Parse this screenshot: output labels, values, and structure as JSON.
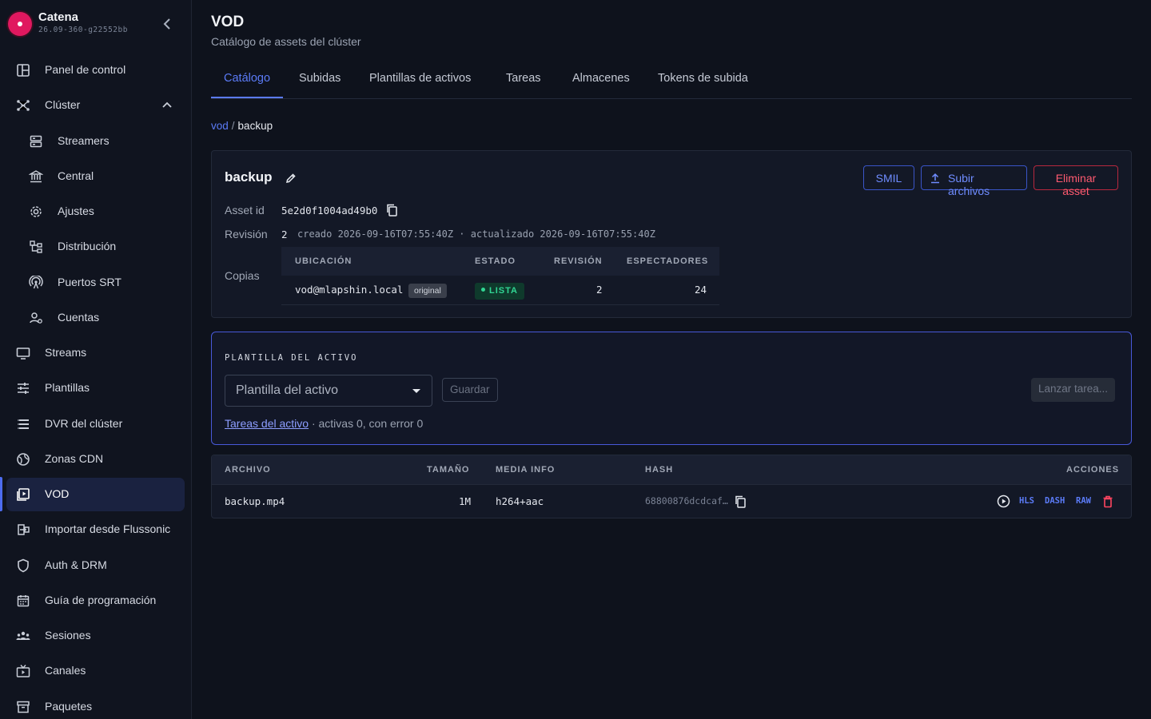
{
  "app": {
    "name": "Catena",
    "version": "26.09-360-g22552bb"
  },
  "sidebar": {
    "items": [
      {
        "label": "Panel de control",
        "icon": "dashboard-icon"
      },
      {
        "label": "Clúster",
        "icon": "cluster-icon",
        "expanded": true
      },
      {
        "label": "Streamers",
        "icon": "server-icon",
        "sub": true
      },
      {
        "label": "Central",
        "icon": "bank-icon",
        "sub": true
      },
      {
        "label": "Ajustes",
        "icon": "gear-icon",
        "sub": true
      },
      {
        "label": "Distribución",
        "icon": "distribution-icon",
        "sub": true
      },
      {
        "label": "Puertos SRT",
        "icon": "antenna-icon",
        "sub": true
      },
      {
        "label": "Cuentas",
        "icon": "accounts-icon",
        "sub": true
      },
      {
        "label": "Streams",
        "icon": "monitor-icon"
      },
      {
        "label": "Plantillas",
        "icon": "sliders-icon"
      },
      {
        "label": "DVR del clúster",
        "icon": "list-icon"
      },
      {
        "label": "Zonas CDN",
        "icon": "globe-icon"
      },
      {
        "label": "VOD",
        "icon": "video-library-icon",
        "active": true
      },
      {
        "label": "Importar desde Flussonic",
        "icon": "import-icon"
      },
      {
        "label": "Auth & DRM",
        "icon": "shield-icon"
      },
      {
        "label": "Guía de programación",
        "icon": "calendar-icon"
      },
      {
        "label": "Sesiones",
        "icon": "users-icon"
      },
      {
        "label": "Canales",
        "icon": "tv-icon"
      },
      {
        "label": "Paquetes",
        "icon": "archive-icon"
      }
    ]
  },
  "page": {
    "title": "VOD",
    "subtitle": "Catálogo de assets del clúster"
  },
  "tabs": [
    {
      "label": "Catálogo",
      "active": true
    },
    {
      "label": "Subidas"
    },
    {
      "label": "Plantillas de activos"
    },
    {
      "label": "Tareas"
    },
    {
      "label": "Almacenes"
    },
    {
      "label": "Tokens de subida"
    }
  ],
  "breadcrumb": {
    "root": "vod",
    "separator": "/",
    "current": "backup"
  },
  "asset": {
    "name": "backup",
    "buttons": {
      "smil": "SMIL",
      "upload": "Subir archivos",
      "delete": "Eliminar asset"
    },
    "id_label": "Asset id",
    "id": "5e2d0f1004ad49b0",
    "revision_label": "Revisión",
    "revision": "2",
    "revision_meta": "creado 2026-09-16T07:55:40Z · actualizado 2026-09-16T07:55:40Z",
    "copies_label": "Copias",
    "copies_table": {
      "headers": [
        "UBICACIÓN",
        "ESTADO",
        "REVISIÓN",
        "ESPECTADORES"
      ],
      "rows": [
        {
          "location": "vod@mlapshin.local",
          "tag": "original",
          "status": "LISTA",
          "revision": "2",
          "viewers": "24"
        }
      ]
    }
  },
  "template_panel": {
    "section_label": "PLANTILLA DEL ACTIVO",
    "select_placeholder": "Plantilla del activo",
    "save_label": "Guardar",
    "launch_label": "Lanzar tarea...",
    "tasks_link": "Tareas del activo",
    "tasks_summary": "· activas 0, con error 0"
  },
  "files_table": {
    "headers": [
      "ARCHIVO",
      "TAMAÑO",
      "MEDIA INFO",
      "HASH",
      "ACCIONES"
    ],
    "rows": [
      {
        "file": "backup.mp4",
        "size": "1M",
        "media": "h264+aac",
        "hash": "68800876dcdcaf…",
        "actions": [
          "HLS",
          "DASH",
          "RAW"
        ]
      }
    ]
  },
  "colors": {
    "accent": "#5b7bf7",
    "danger": "#ff5a70",
    "success": "#31d694",
    "brand": "#e0185f",
    "background": "#0e121c"
  }
}
